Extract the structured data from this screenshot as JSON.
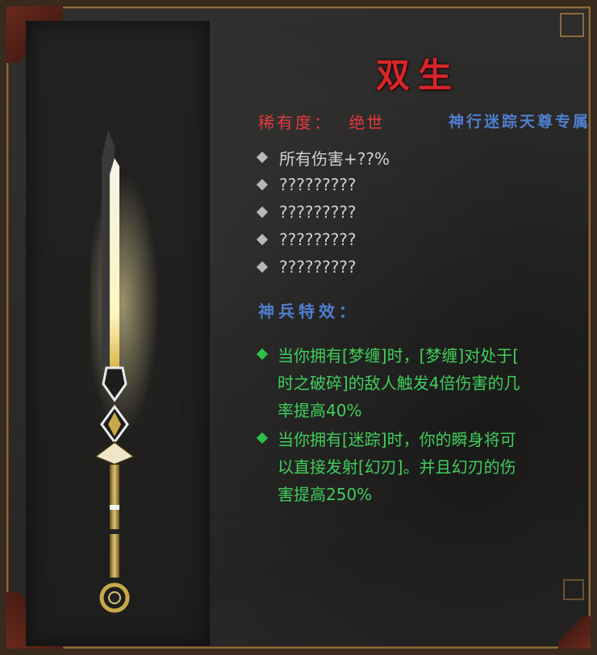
{
  "item": {
    "name": "双生",
    "rarity_label": "稀有度：",
    "rarity_value": "绝世",
    "exclusive": "神行迷踪天尊专属",
    "icon": "spear-icon"
  },
  "stats": [
    "所有伤害+??%",
    "?????????",
    "?????????",
    "?????????",
    "?????????"
  ],
  "special_effects": {
    "header": "神兵特效：",
    "items": [
      "当你拥有[梦缠]时，[梦缠]对处于[\n时之破碎]的敌人触发4倍伤害的几\n率提高40%",
      "当你拥有[迷踪]时，你的瞬身将可\n以直接发射[幻刃]。并且幻刃的伤\n害提高250%"
    ]
  },
  "colors": {
    "title": "#d8262b",
    "rarity": "#e43a3e",
    "exclusive": "#4f7fd0",
    "effect_text": "#3fcf5b",
    "stat_text": "#cfcfcf"
  }
}
